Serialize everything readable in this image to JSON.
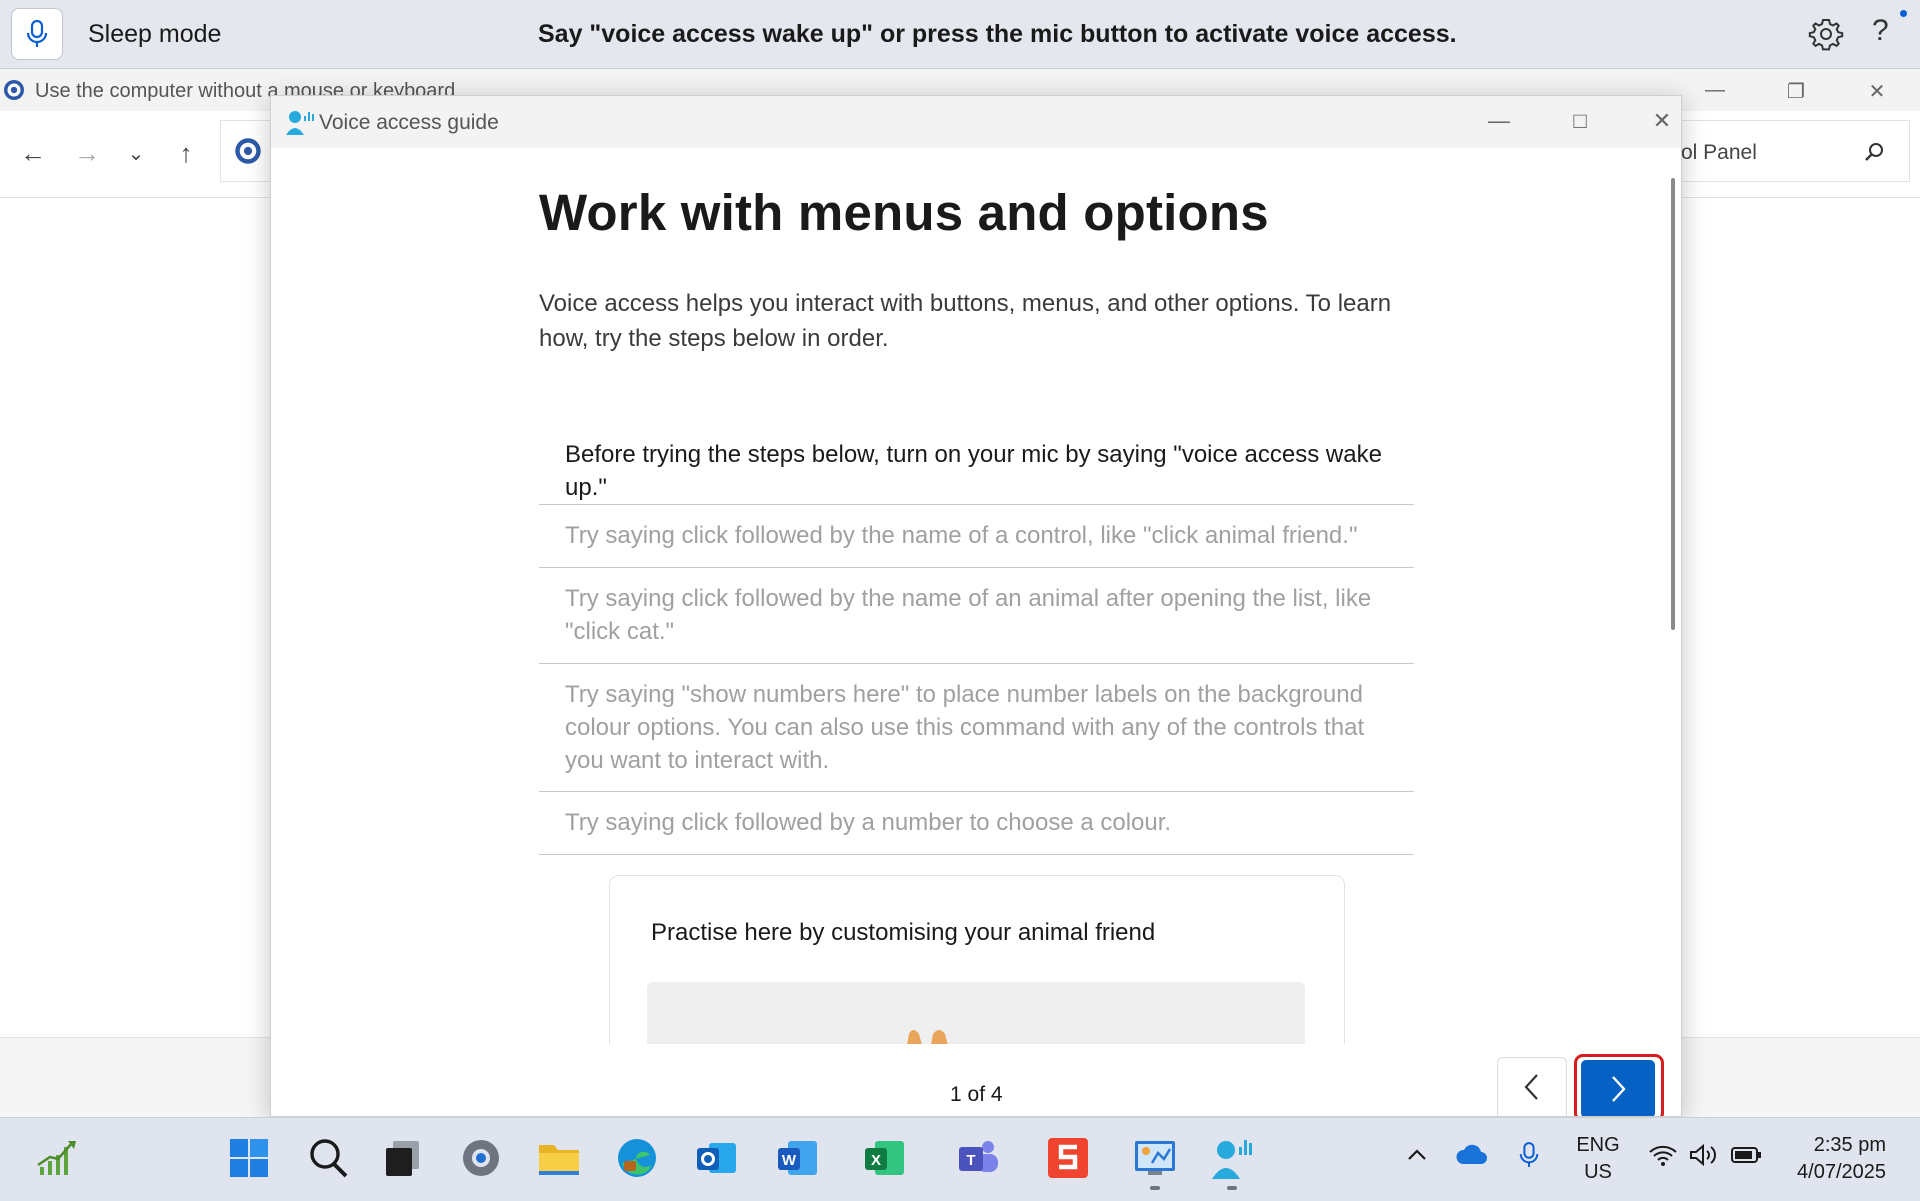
{
  "voice_bar": {
    "mode": "Sleep mode",
    "message": "Say \"voice access wake up\" or press the mic button to activate voice access.",
    "help_label": "?"
  },
  "background_window": {
    "title": "Use the computer without a mouse or keyboard",
    "search_text": "ol Panel"
  },
  "guide": {
    "window_title": "Voice access guide",
    "heading": "Work with menus and options",
    "intro": "Voice access helps you interact with buttons, menus, and other options. To learn how, try the steps below in order.",
    "steps": [
      {
        "text": "Before trying the steps below, turn on your mic by saying \"voice access wake up.\"",
        "active": true
      },
      {
        "text": "Try saying click followed by the name of a control, like \"click animal friend.\"",
        "active": false
      },
      {
        "text": "Try saying click followed by the name of an animal after opening the list, like \"click cat.\"",
        "active": false
      },
      {
        "text": "Try saying \"show numbers here\" to place number labels on the background colour options. You can also use this command with any of the controls that you want to interact with.",
        "active": false
      },
      {
        "text": "Try saying click followed by a number to choose a colour.",
        "active": false
      }
    ],
    "practice_title": "Practise here by customising your animal friend",
    "page_indicator": "1 of 4"
  },
  "taskbar": {
    "apps": [
      "stocks-widget",
      "start",
      "search",
      "task-view",
      "settings",
      "file-explorer",
      "edge",
      "outlook",
      "word",
      "excel",
      "teams",
      "snagit",
      "control-panel",
      "voice-access"
    ],
    "tray": {
      "lang_line1": "ENG",
      "lang_line2": "US",
      "time": "2:35 pm",
      "date": "4/07/2025"
    }
  },
  "colors": {
    "accent_blue": "#0561c3",
    "focus_red": "#d51c20",
    "taskbar_bg": "#dfe4ef",
    "voice_bar_bg": "#e4e7ee"
  }
}
